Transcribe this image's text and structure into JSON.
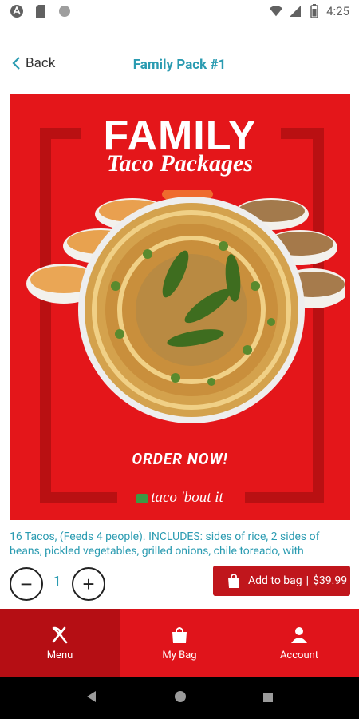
{
  "status_bar": {
    "time": "4:25"
  },
  "header": {
    "back_label": "Back",
    "title": "Family Pack #1"
  },
  "promo": {
    "title": "FAMILY",
    "subtitle": "Taco Packages",
    "cta": "ORDER NOW!",
    "brand": "taco 'bout it"
  },
  "product": {
    "description": "16 Tacos, (Feeds 4 people). INCLUDES:  sides of rice, 2 sides of beans, pickled vegetables, grilled onions, chile toreado, with",
    "quantity": "1",
    "add_label": "Add to bag",
    "price": "$39.99"
  },
  "nav": {
    "items": [
      {
        "label": "Menu"
      },
      {
        "label": "My Bag"
      },
      {
        "label": "Account"
      }
    ]
  },
  "colors": {
    "accent": "#2a9bb1",
    "brand_red": "#e0141b",
    "button_red": "#c0161c"
  }
}
